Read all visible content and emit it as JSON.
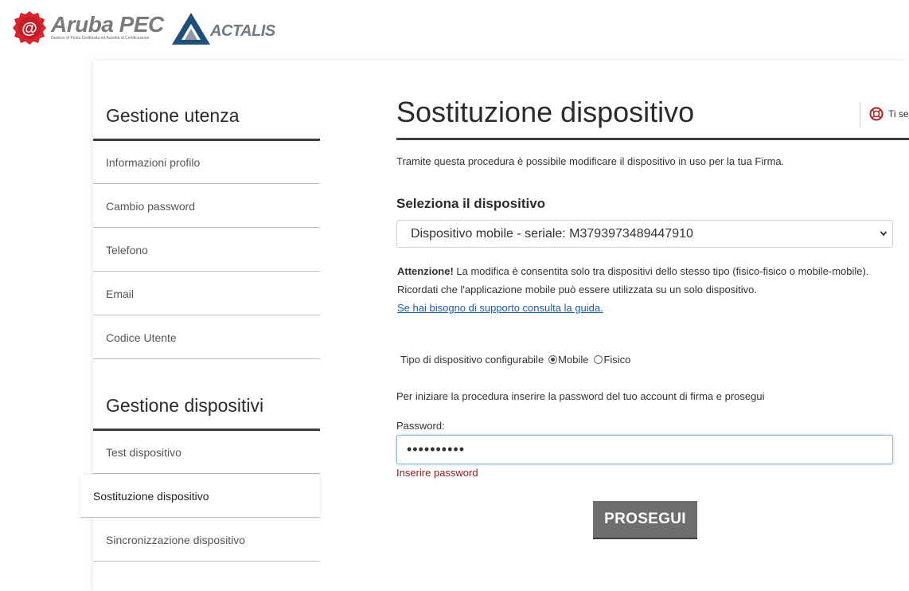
{
  "header": {
    "aruba_brand": "Aruba PEC",
    "aruba_tagline": "Gestore di Posta Certificata ed Autorità di Certificazione",
    "actalis_brand": "ACTALIS"
  },
  "sidebar": {
    "sections": [
      {
        "heading": "Gestione utenza",
        "items": [
          {
            "label": "Informazioni profilo"
          },
          {
            "label": "Cambio password"
          },
          {
            "label": "Telefono"
          },
          {
            "label": "Email"
          },
          {
            "label": "Codice Utente"
          }
        ]
      },
      {
        "heading": "Gestione dispositivi",
        "items": [
          {
            "label": "Test dispositivo"
          },
          {
            "label": "Sostituzione dispositivo",
            "active": true
          },
          {
            "label": "Sincronizzazione dispositivo"
          }
        ]
      }
    ]
  },
  "main": {
    "title": "Sostituzione dispositivo",
    "help_text": "Ti se",
    "intro": "Tramite questa procedura è possibile modificare il dispositivo in uso per la tua Firma.",
    "select_label": "Seleziona il dispositivo",
    "select_value": "Dispositivo mobile - seriale: M3793973489447910",
    "warning_strong": "Attenzione!",
    "warning_text": " La modifica è consentita solo tra dispositivi dello stesso tipo (fisico-fisico o mobile-mobile).",
    "warning_line2": "Ricordati che l'applicazione mobile può essere utilizzata su un solo dispositivo.",
    "guide_link": "Se hai bisogno di supporto consulta la guida.",
    "device_type_label": "Tipo di dispositivo configurabile",
    "device_type_options": [
      {
        "label": "Mobile",
        "checked": true
      },
      {
        "label": "Fisico",
        "checked": false
      }
    ],
    "password_instructions": "Per iniziare la procedura inserire la password del tuo account di firma e prosegui",
    "password_label": "Password:",
    "password_value": "••••••••••",
    "password_error": "Inserire password",
    "submit_label": "PROSEGUI"
  },
  "colors": {
    "aruba_red": "#d9232d",
    "actalis_blue": "#1f4e79",
    "error": "#8b1a1a",
    "link": "#1a5aa6",
    "button": "#6e6e6e"
  }
}
